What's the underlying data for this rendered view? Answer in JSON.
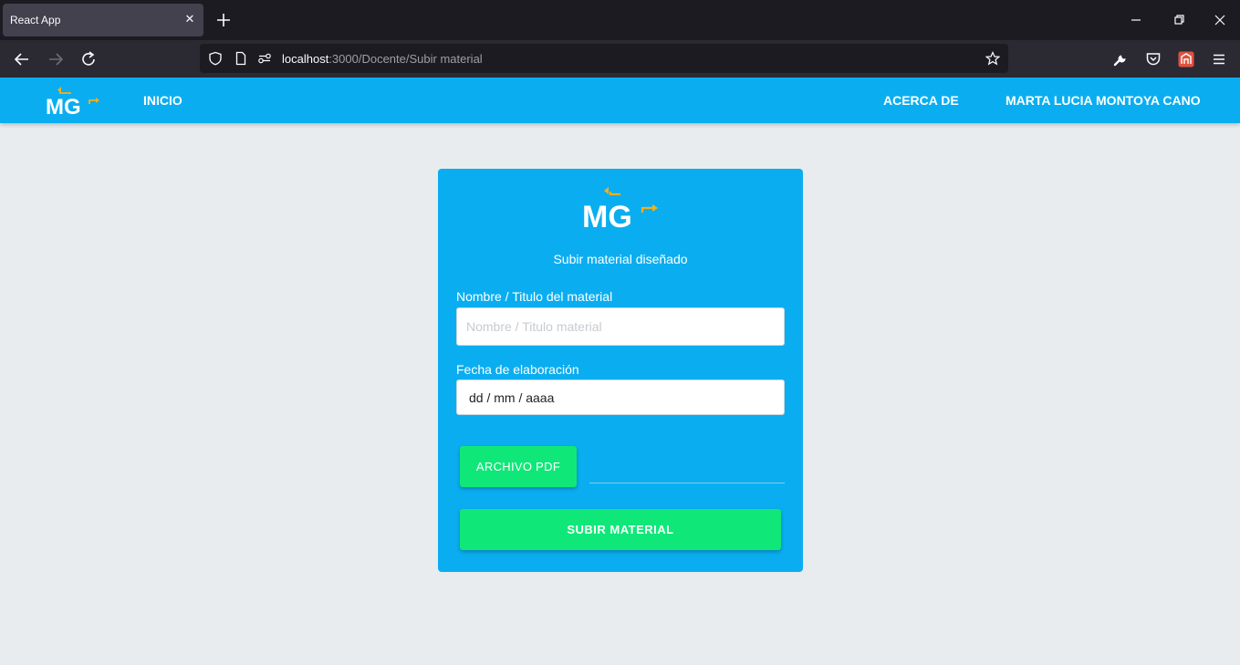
{
  "browser": {
    "tab_title": "React App",
    "url_host": "localhost",
    "url_rest": ":3000/Docente/Subir material"
  },
  "header": {
    "logo_text": "MG",
    "nav_home": "INICIO",
    "nav_about": "ACERCA DE",
    "user_name": "MARTA LUCIA MONTOYA CANO"
  },
  "form": {
    "title": "Subir material diseñado",
    "name_label": "Nombre / Titulo del material",
    "name_placeholder": "Nombre / Titulo material",
    "date_label": "Fecha de elaboración",
    "date_value": "dd / mm / aaaa",
    "pdf_button": "ARCHIVO PDF",
    "submit_button": "SUBIR MATERIAL"
  },
  "colors": {
    "accent": "#0aaef0",
    "button": "#0fe878",
    "page_bg": "#e8ecee",
    "logo_arrow": "#f2b01e"
  }
}
